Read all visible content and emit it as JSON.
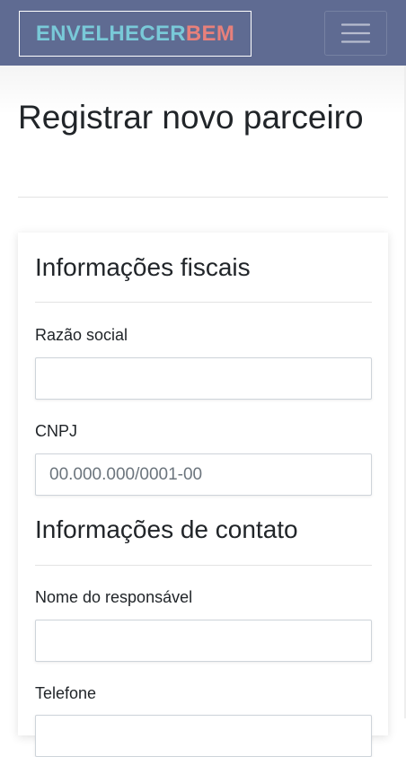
{
  "navbar": {
    "brand_part1": "ENVELHECER",
    "brand_part2": "BEM",
    "toggler_icon": "hamburger-menu-icon",
    "colors": {
      "background": "#5f6b92",
      "brand_part1": "#79c9d8",
      "brand_part2": "#e8807b"
    }
  },
  "page": {
    "title": "Registrar novo parceiro"
  },
  "form": {
    "fiscal_section": {
      "title": "Informações fiscais",
      "razao_social": {
        "label": "Razão social",
        "value": "",
        "placeholder": ""
      },
      "cnpj": {
        "label": "CNPJ",
        "value": "",
        "placeholder": "00.000.000/0001-00"
      }
    },
    "contact_section": {
      "title": "Informações de contato",
      "responsavel": {
        "label": "Nome do responsável",
        "value": "",
        "placeholder": ""
      },
      "telefone": {
        "label": "Telefone",
        "value": "",
        "placeholder": ""
      }
    }
  }
}
